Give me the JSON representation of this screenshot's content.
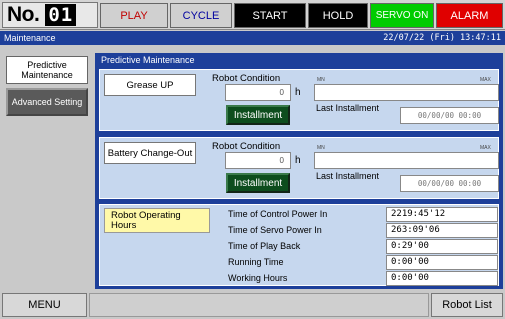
{
  "header": {
    "robot_no_label": "No.",
    "robot_no_value": "01",
    "status": {
      "play": "PLAY",
      "cycle": "CYCLE",
      "start": "START",
      "hold": "HOLD",
      "servo_on": "SERVO ON",
      "alarm": "ALARM"
    },
    "colors": {
      "servo_on": "#00cc00",
      "alarm": "#e00000",
      "title_bar": "#1d3f9a"
    }
  },
  "title_bar": {
    "title": "Maintenance",
    "datetime": "22/07/22 (Fri) 13:47:11"
  },
  "nav": {
    "predictive": "Predictive Maintenance",
    "advanced": "Advanced Setting"
  },
  "panel": {
    "title": "Predictive Maintenance",
    "grease": {
      "label": "Grease UP",
      "condition_label": "Robot Condition",
      "hours_value": "0",
      "unit": "h",
      "min": "MN",
      "max": "MAX",
      "install_button": "Installment",
      "last_label": "Last Installment",
      "last_value": "00/00/00  00:00"
    },
    "battery": {
      "label": "Battery Change-Out",
      "condition_label": "Robot Condition",
      "hours_value": "0",
      "unit": "h",
      "min": "MN",
      "max": "MAX",
      "install_button": "Installment",
      "last_label": "Last Installment",
      "last_value": "00/00/00  00:00"
    },
    "operating_hours": {
      "label": "Robot Operating Hours",
      "rows": [
        {
          "label": "Time of Control Power In",
          "value": "2219:45'12"
        },
        {
          "label": "Time of Servo Power In",
          "value": "263:09'06"
        },
        {
          "label": "Time of Play Back",
          "value": "0:29'00"
        },
        {
          "label": "Running Time",
          "value": "0:00'00"
        },
        {
          "label": "Working Hours",
          "value": "0:00'00"
        }
      ]
    }
  },
  "bottom": {
    "menu": "MENU",
    "robot_list": "Robot List"
  }
}
